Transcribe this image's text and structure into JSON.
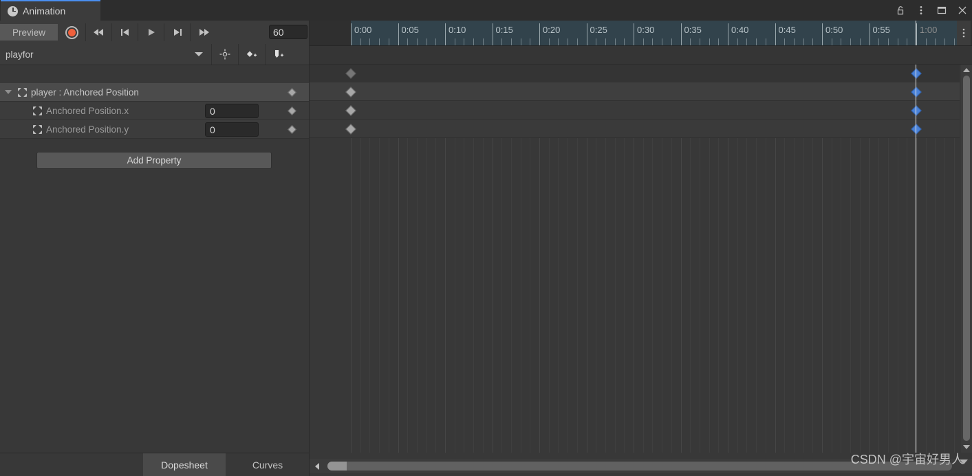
{
  "window": {
    "tab_label": "Animation",
    "tab_icon": "clock-icon",
    "controls": [
      {
        "name": "lock-icon",
        "glyph": "unlock"
      },
      {
        "name": "more-options-icon",
        "glyph": "kebab"
      },
      {
        "name": "maximize-icon",
        "glyph": "square"
      },
      {
        "name": "close-icon",
        "glyph": "x"
      }
    ]
  },
  "toolbar": {
    "preview_label": "Preview",
    "record_label": "record-button",
    "first_frame_label": "first-frame-button",
    "prev_frame_label": "previous-frame-button",
    "play_label": "play-button",
    "next_frame_label": "next-frame-button",
    "last_frame_label": "last-frame-button",
    "frame_value": "60",
    "clip_name": "playfor",
    "filter_icon": "target-icon",
    "add_keyframe_icon": "add-keyframe-icon",
    "add_event_icon": "add-event-icon"
  },
  "properties": {
    "group": {
      "label": "player : Anchored Position",
      "icon": "animation-clip-icon",
      "foldout": "expanded"
    },
    "rows": [
      {
        "label": "Anchored Position.x",
        "value": "0",
        "icon": "animation-clip-icon"
      },
      {
        "label": "Anchored Position.y",
        "value": "0",
        "icon": "animation-clip-icon"
      }
    ],
    "add_property_label": "Add Property"
  },
  "bottom_tabs": {
    "dopesheet_label": "Dopesheet",
    "curves_label": "Curves",
    "active": "Dopesheet"
  },
  "timeline": {
    "tick_labels": [
      "0:00",
      "0:05",
      "0:10",
      "0:15",
      "0:20",
      "0:25",
      "0:30",
      "0:35",
      "0:40",
      "0:45",
      "0:50",
      "0:55",
      "1:00"
    ],
    "playhead_time": "1:00",
    "frame_rate": "60",
    "keyframes": [
      {
        "row": "summary",
        "times": [
          "0:00",
          "1:00"
        ]
      },
      {
        "row": "player : Anchored Position",
        "times": [
          "0:00",
          "1:00"
        ]
      },
      {
        "row": "Anchored Position.x",
        "times": [
          "0:00",
          "1:00"
        ]
      },
      {
        "row": "Anchored Position.y",
        "times": [
          "0:00",
          "1:00"
        ]
      }
    ]
  },
  "colors": {
    "accent": "#4a8ef0",
    "record": "#f0603c",
    "keyframe_selected": "#4a82d8",
    "keyframe_normal": "#a8a8a8",
    "ruler_bg": "#32434c",
    "panel_bg": "#383838"
  },
  "watermark": {
    "text": "CSDN @宇宙好男人"
  }
}
